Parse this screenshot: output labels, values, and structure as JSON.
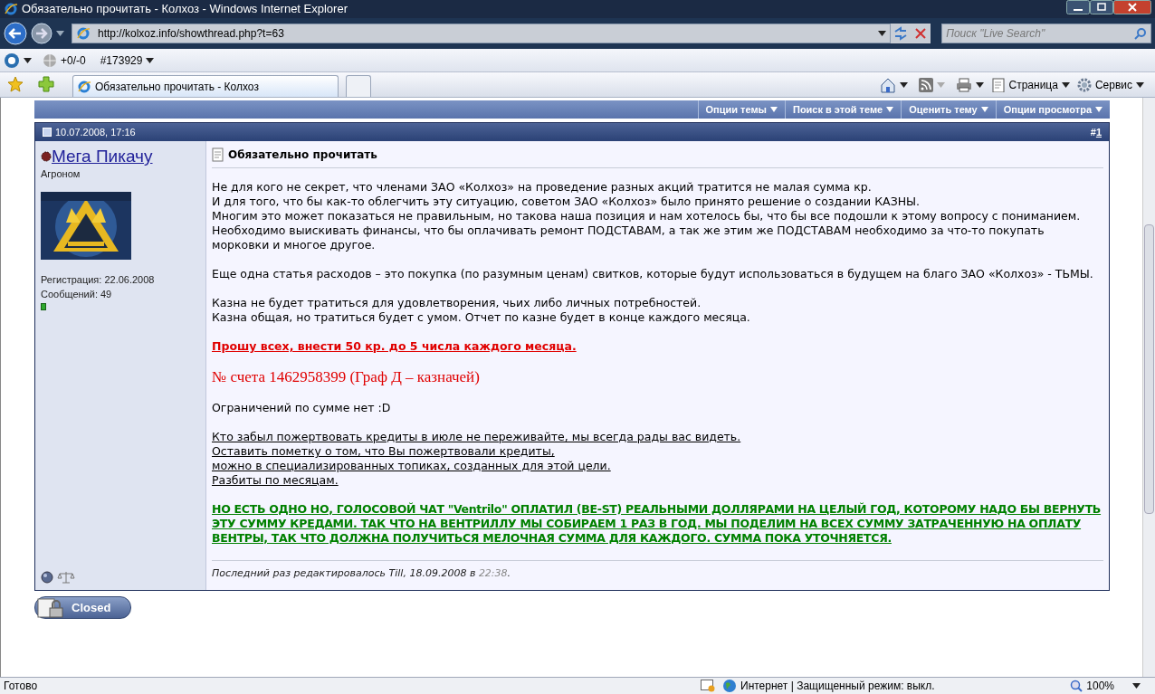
{
  "window": {
    "title": "Обязательно прочитать - Колхоз - Windows Internet Explorer"
  },
  "address_bar": {
    "url": "http://kolxoz.info/showthread.php?t=63",
    "search_placeholder": "Поиск \"Live Search\""
  },
  "links_bar": {
    "rating": "+0/-0",
    "rank": "#173929"
  },
  "tabs": [
    {
      "label": "Обязательно прочитать - Колхоз",
      "selected": true
    }
  ],
  "command_bar": [
    "Страница",
    "Сервис"
  ],
  "thread_tools": [
    "Опции темы",
    "Поиск в этой теме",
    "Оценить тему",
    "Опции просмотра"
  ],
  "post": {
    "date": "10.07.2008, 17:16",
    "number_prefix": "#",
    "number": "1",
    "user": {
      "name": "Мега Пикачу",
      "title": "Агроном",
      "registered": "Регистрация: 22.06.2008",
      "posts": "Сообщений: 49",
      "online": true
    },
    "title": "Обязательно прочитать",
    "blocks": [
      {
        "kind": "normal",
        "lines": [
          "Не для кого не секрет, что членами ЗАО «Колхоз» на проведение разных акций тратится не малая сумма кр.",
          "И для того, что бы как-то облегчить эту ситуацию, советом ЗАО «Колхоз» было принято решение о создании КАЗНЫ.",
          "Многим это может показаться не правильным, но такова наша позиция и нам хотелось бы, что бы все подошли к этому вопросу с пониманием.",
          "Необходимо выискивать финансы, что бы оплачивать ремонт ПОДСТАВАМ, а так же этим же ПОДСТАВАМ необходимо за что-то покупать морковки и многое другое."
        ]
      },
      {
        "kind": "normal",
        "lines": [
          "Еще одна статья расходов – это покупка (по разумным ценам) свитков, которые будут использоваться в будущем на благо ЗАО «Колхоз» - ТЬМЫ."
        ]
      },
      {
        "kind": "normal",
        "lines": [
          "Казна не будет тратиться для удовлетворения, чьих либо личных потребностей.",
          "Казна общая, но тратиться будет с умом. Отчет по казне будет в конце каждого месяца."
        ]
      },
      {
        "kind": "alert",
        "lines": [
          "Прошу всех, внести 50 кр. до 5 числа каждого месяца."
        ]
      },
      {
        "kind": "account",
        "lines": [
          "№ счета 1462958399 (Граф Д – казначей)"
        ]
      },
      {
        "kind": "normal",
        "lines": [
          "Ограничений по сумме нет :D"
        ]
      },
      {
        "kind": "underlined",
        "lines": [
          "Кто забыл пожертвовать кредиты в июле не переживайте, мы всегда рады вас видеть.",
          "Оставить пометку о том, что Вы пожертвовали кредиты,",
          "можно в специализированных топиках, созданных для этой цели.",
          "Разбиты по месяцам."
        ]
      },
      {
        "kind": "notice",
        "lines": [
          "НО ЕСТЬ ОДНО НО, ГОЛОСОВОЙ ЧАТ \"Ventrilo\" ОПЛАТИЛ (BE-ST) РЕАЛЬНЫМИ ДОЛЛЯРАМИ НА ЦЕЛЫЙ ГОД, КОТОРОМУ НАДО БЫ ВЕРНУТЬ ЭТУ СУММУ КРЕДАМИ. ТАК ЧТО НА ВЕНТРИЛЛУ МЫ СОБИРАЕМ 1 РАЗ В ГОД. МЫ ПОДЕЛИМ НА ВСЕХ СУММУ ЗАТРАЧЕННУЮ НА ОПЛАТУ ВЕНТРЫ, ТАК ЧТО ДОЛЖНА ПОЛУЧИТЬСЯ МЕЛОЧНАЯ СУММА ДЛЯ КАЖДОГО. СУММА ПОКА УТОЧНЯЕТСЯ."
        ]
      }
    ],
    "edit_note": "Последний раз редактировалось Till, 18.09.2008 в ",
    "edit_time": "22:38",
    "edit_end": "."
  },
  "closed_button": "Closed",
  "status_bar": {
    "text": "Готово",
    "zone": "Интернет | Защищенный режим: выкл.",
    "zoom": "100%"
  }
}
